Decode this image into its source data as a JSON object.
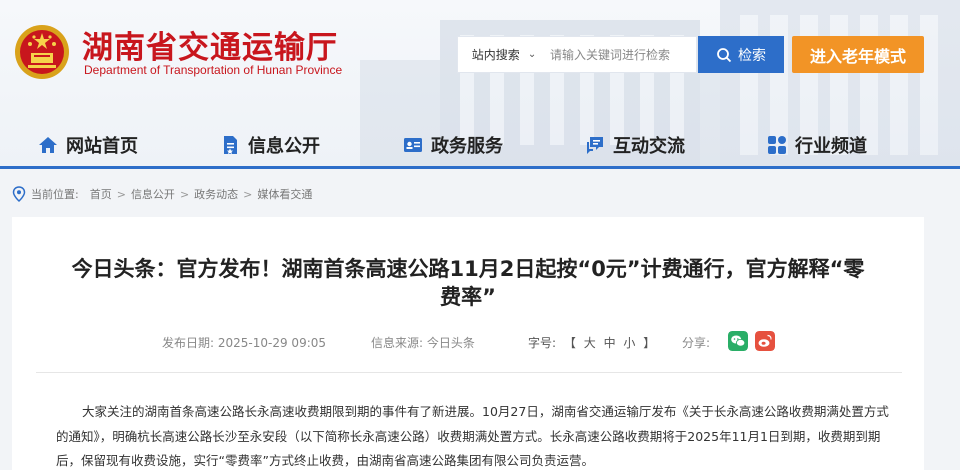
{
  "site": {
    "title": "湖南省交通运输厅",
    "subtitle": "Department of Transportation of Hunan Province"
  },
  "search": {
    "scope_label": "站内搜索",
    "placeholder": "请输入关键词进行检索",
    "button_label": "检索",
    "button_icon": "search-icon"
  },
  "elder_mode_label": "进入老年模式",
  "nav": {
    "items": [
      {
        "label": "网站首页",
        "icon": "home-icon"
      },
      {
        "label": "信息公开",
        "icon": "document-icon"
      },
      {
        "label": "政务服务",
        "icon": "id-card-icon"
      },
      {
        "label": "互动交流",
        "icon": "chat-icon"
      },
      {
        "label": "行业频道",
        "icon": "grid-icon"
      }
    ]
  },
  "breadcrumb": {
    "label": "当前位置:",
    "items": [
      "首页",
      "信息公开",
      "政务动态",
      "媒体看交通"
    ],
    "separator": ">"
  },
  "article": {
    "title": "今日头条：官方发布！湖南首条高速公路11月2日起按“0元”计费通行，官方解释“零费率”",
    "publish_label": "发布日期:",
    "publish_date": "2025-10-29 09:05",
    "source_label": "信息来源:",
    "source": "今日头条",
    "font_label": "字号:",
    "font_sizes": [
      "大",
      "中",
      "小"
    ],
    "share_label": "分享:",
    "body": "大家关注的湖南首条高速公路长永高速收费期限到期的事件有了新进展。10月27日，湖南省交通运输厅发布《关于长永高速公路收费期满处置方式的通知》，明确杭长高速公路长沙至永安段（以下简称长永高速公路）收费期满处置方式。长永高速公路收费期将于2025年11月1日到期，收费期到期后，保留现有收费设施，实行“零费率”方式终止收费，由湖南省高速公路集团有限公司负责运营。"
  },
  "colors": {
    "brand_red": "#c8161d",
    "primary_blue": "#2d6ec9",
    "elder_orange": "#f29426",
    "wechat_green": "#2aae67",
    "weibo_red": "#e6513f"
  }
}
